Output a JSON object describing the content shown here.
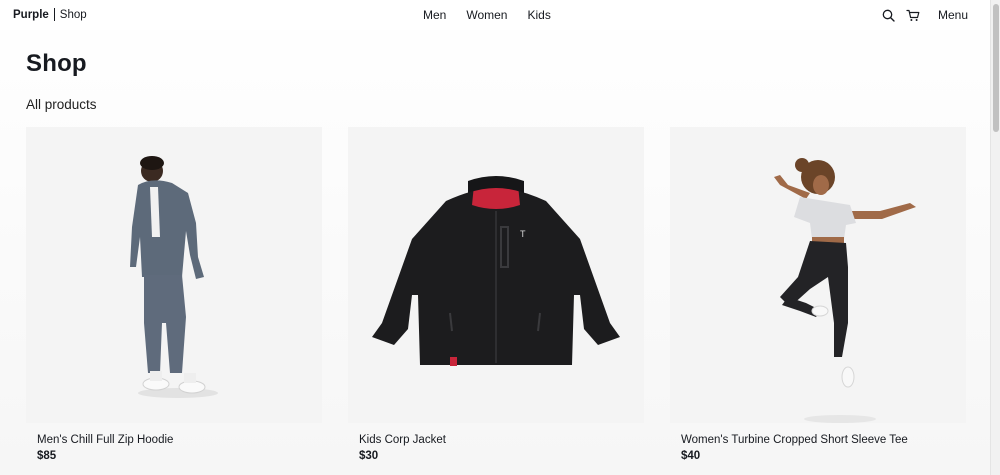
{
  "header": {
    "brand": "Purple",
    "section": "Shop",
    "nav": [
      "Men",
      "Women",
      "Kids"
    ],
    "menu_label": "Menu",
    "icons": [
      "search-icon",
      "cart-icon"
    ]
  },
  "main": {
    "title": "Shop",
    "subtitle": "All products",
    "products": [
      {
        "name": "Men's Chill Full Zip Hoodie",
        "price": "$85"
      },
      {
        "name": "Kids Corp Jacket",
        "price": "$30"
      },
      {
        "name": "Women's Turbine Cropped Short Sleeve Tee",
        "price": "$40"
      }
    ]
  }
}
